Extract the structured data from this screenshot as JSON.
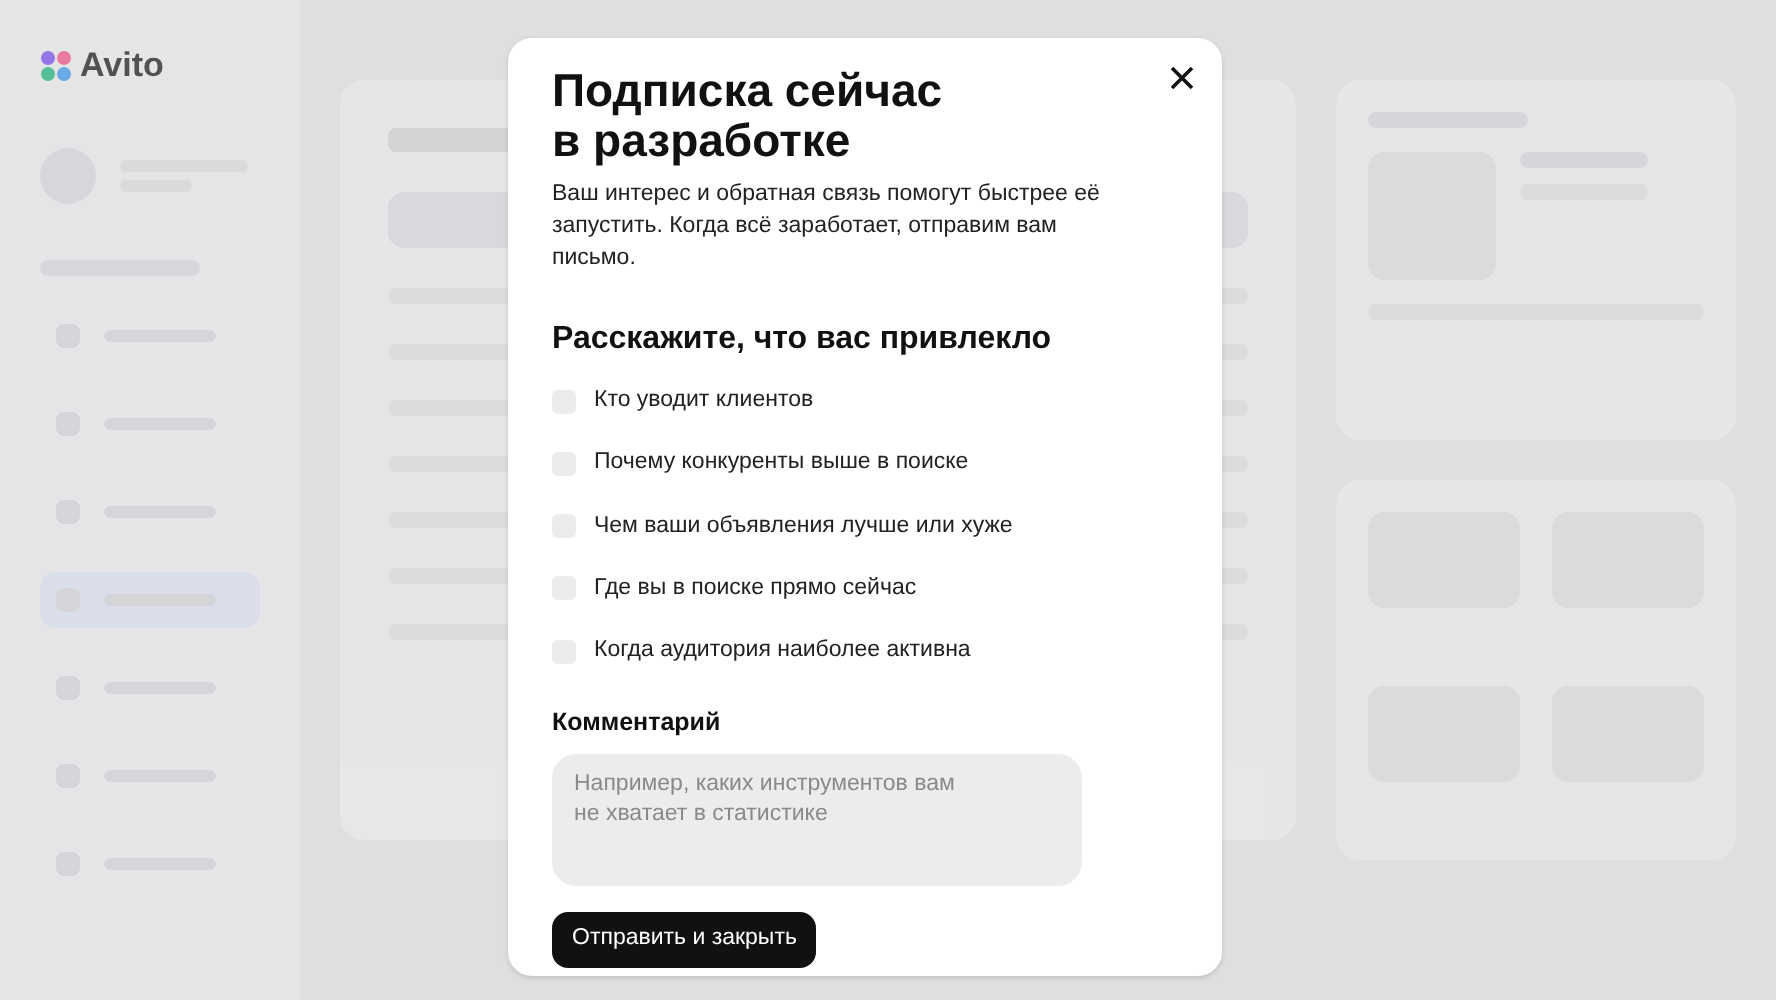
{
  "logo": {
    "text": "Avito"
  },
  "modal": {
    "title": "Подписка сейчас в разработке",
    "description": "Ваш интерес и обратная связь помогут быстрее её запустить. Когда всё заработает, отправим вам письмо.",
    "question": "Расскажите, что вас привлекло",
    "options": [
      {
        "label": "Кто уводит клиентов",
        "checked": false
      },
      {
        "label": "Почему конкуренты выше в поиске",
        "checked": false
      },
      {
        "label": "Чем ваши объявления лучше или хуже",
        "checked": false
      },
      {
        "label": "Где вы в поиске прямо сейчас",
        "checked": false
      },
      {
        "label": "Когда аудитория наиболее активна",
        "checked": false
      }
    ],
    "comment": {
      "label": "Комментарий",
      "placeholder": "Например, каких инструментов вам не хватает в статистике"
    },
    "submit": "Отправить и закрыть"
  }
}
